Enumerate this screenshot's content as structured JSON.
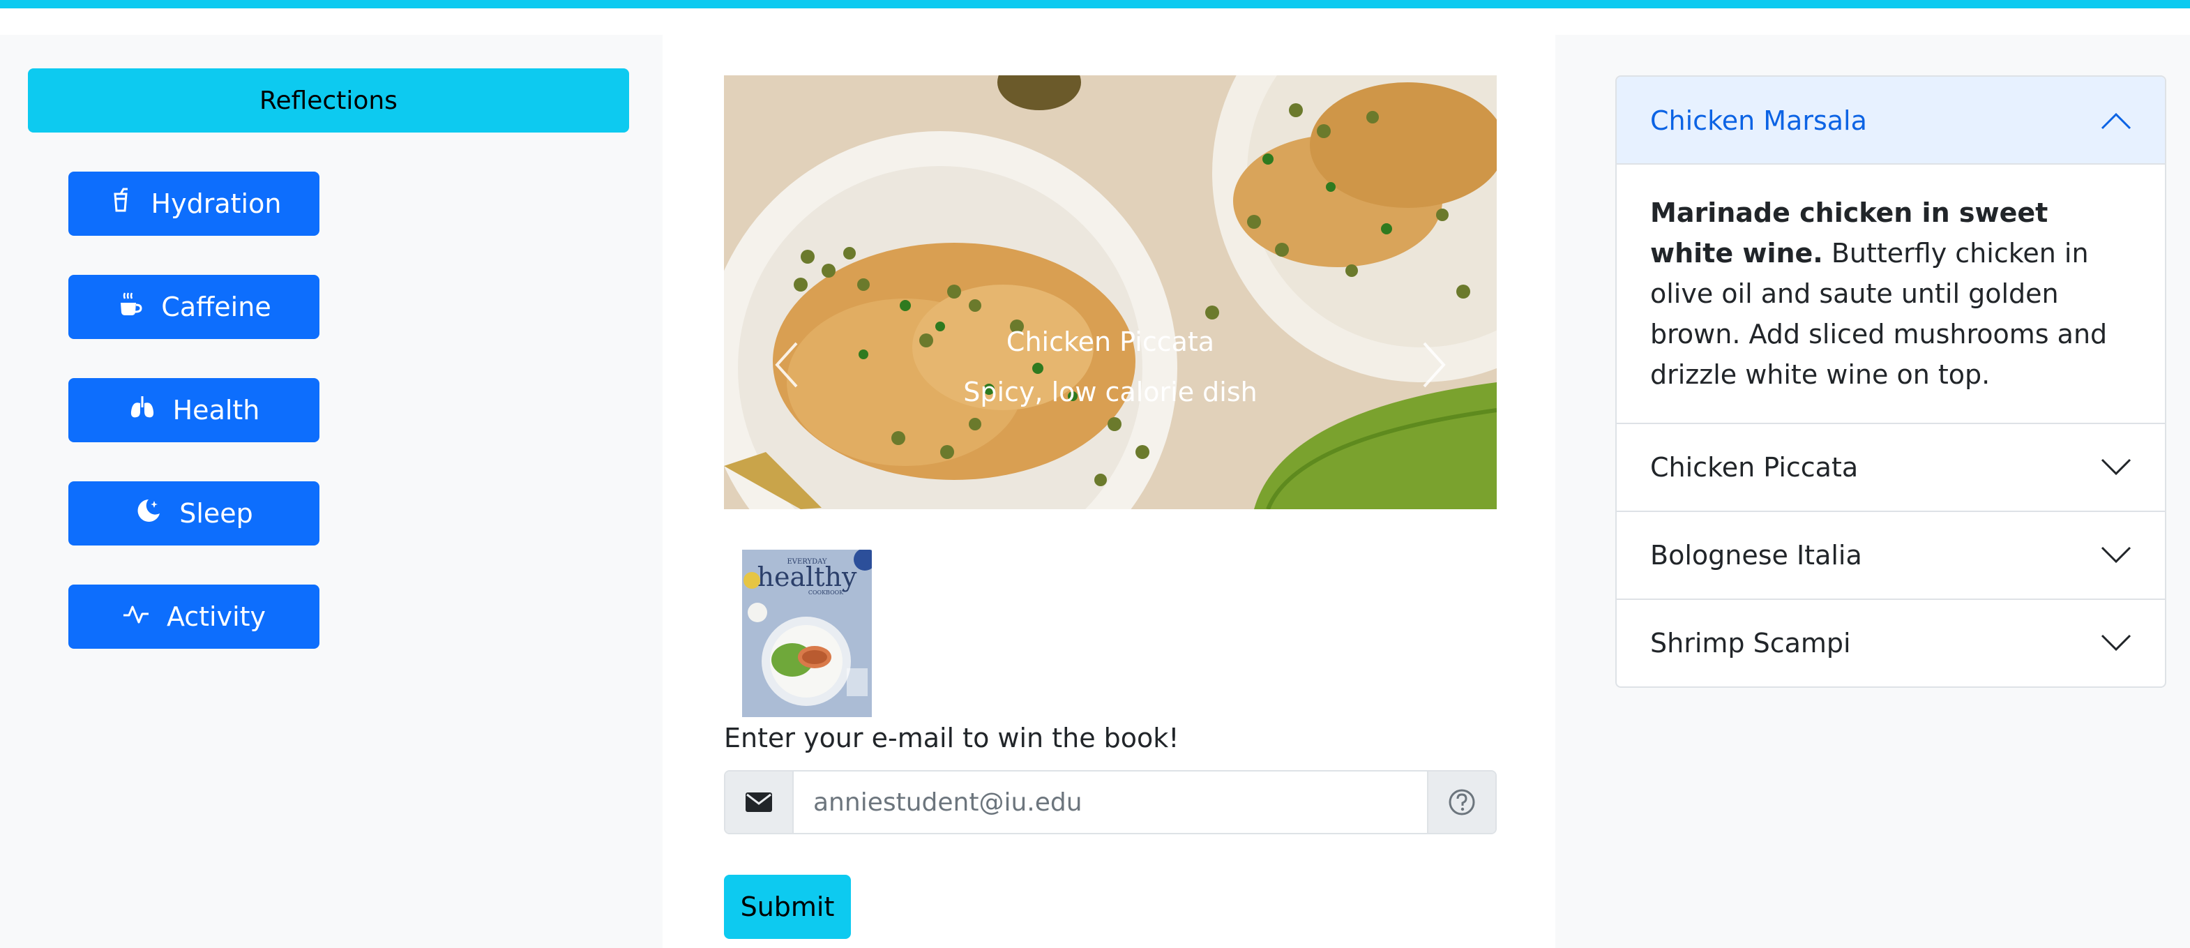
{
  "sidebar": {
    "header_label": "Reflections",
    "items": [
      {
        "label": "Hydration",
        "icon": "cup-icon"
      },
      {
        "label": "Caffeine",
        "icon": "hot-cup-icon"
      },
      {
        "label": "Health",
        "icon": "lungs-icon"
      },
      {
        "label": "Sleep",
        "icon": "moon-stars-icon"
      },
      {
        "label": "Activity",
        "icon": "activity-icon"
      }
    ]
  },
  "carousel": {
    "caption_title": "Chicken Piccata",
    "caption_text": "Spicy, low calorie dish",
    "slide_count": 4,
    "active_index": 1
  },
  "promo": {
    "book_title": "healthy",
    "book_title_top": "EVERYDAY",
    "book_title_bottom": "COOKBOOK",
    "prompt": "Enter your e-mail to win the book!",
    "email_placeholder": "anniestudent@iu.edu",
    "submit_label": "Submit"
  },
  "accordion": {
    "items": [
      {
        "title": "Chicken Marsala",
        "expanded": true,
        "body_bold": "Marinade chicken in sweet white wine.",
        "body_text": " Butterfly chicken in olive oil and saute until golden brown. Add sliced mushrooms and drizzle white wine on top."
      },
      {
        "title": "Chicken Piccata",
        "expanded": false
      },
      {
        "title": "Bolognese Italia",
        "expanded": false
      },
      {
        "title": "Shrimp Scampi",
        "expanded": false
      }
    ]
  },
  "colors": {
    "primary": "#0d6efd",
    "info": "#0dcaf0",
    "accordion_active_bg": "#e7f1ff",
    "accordion_active_text": "#0c63e4"
  }
}
